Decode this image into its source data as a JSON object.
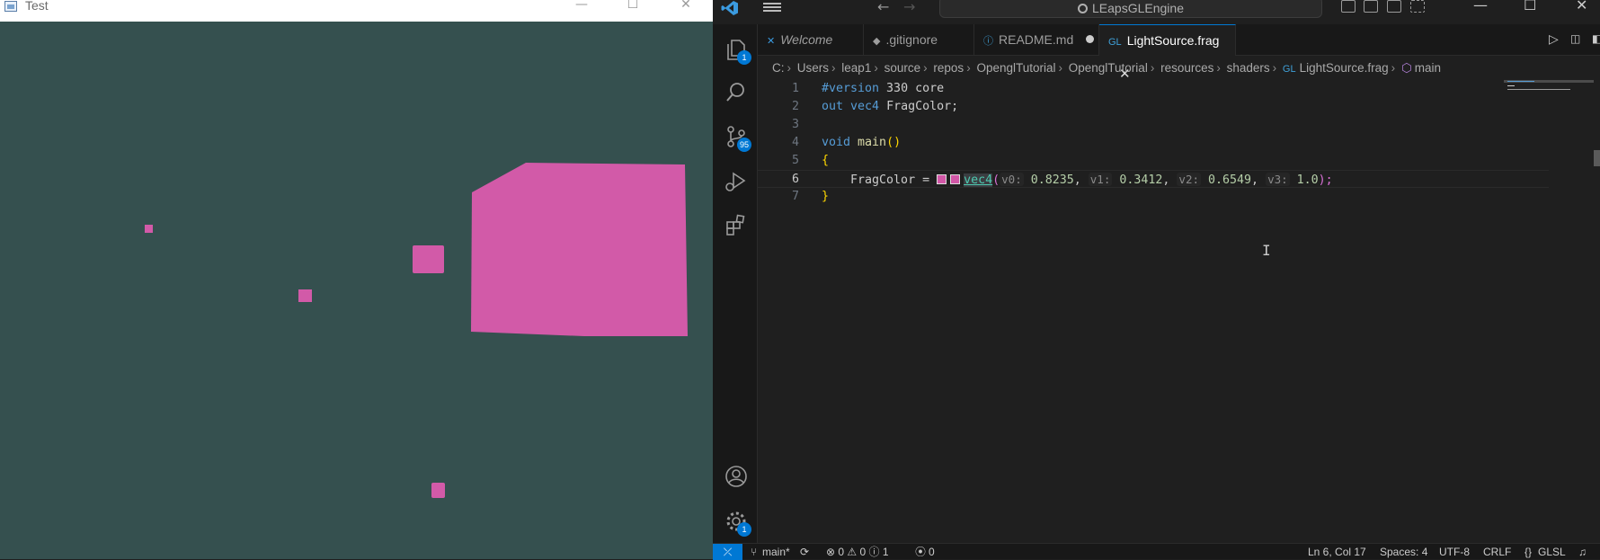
{
  "test_window": {
    "title": "Test",
    "controls": {
      "minimize": "—",
      "maximize": "☐",
      "close": "✕"
    },
    "clear_color": "#35504f",
    "object_color": "#d25aa8"
  },
  "vscode": {
    "title_bar": {
      "search_text": "LEapsGLEngine",
      "back": "←",
      "forward": "→",
      "minimize": "—",
      "maximize": "☐",
      "close": "✕"
    },
    "activity_bar": {
      "explorer_badge": "1",
      "source_control_badge": "95",
      "manage_badge": "1"
    },
    "tabs": [
      {
        "label": "Welcome",
        "icon": "vscode-icon"
      },
      {
        "label": ".gitignore",
        "icon": "diamond-icon",
        "prefix": "◆"
      },
      {
        "label": "README.md",
        "icon": "info-icon",
        "prefix": "ⓘ"
      },
      {
        "label": "LightSource.frag",
        "icon": "glsl-icon",
        "prefix": "GL"
      }
    ],
    "breadcrumb": [
      "C:",
      "Users",
      "leap1",
      "source",
      "repos",
      "OpenglTutorial",
      "OpenglTutorial",
      "resources",
      "shaders",
      "LightSource.frag",
      "main"
    ],
    "code": {
      "line_numbers": [
        "1",
        "2",
        "3",
        "4",
        "5",
        "6",
        "7"
      ],
      "l1_directive": "#version",
      "l1_rest": " 330 core",
      "l2_kw": "out",
      "l2_type": " vec4",
      "l2_rest": " FragColor;",
      "l4_kw": "void",
      "l4_fn": " main",
      "l4_parens": "()",
      "l5_brace": "{",
      "l6_lhs": "    FragColor = ",
      "l6_func": "vec4",
      "l6_open": "(",
      "l6_hint0": "v0:",
      "l6_val0": " 0.8235",
      "l6_comma0": ", ",
      "l6_hint1": "v1:",
      "l6_val1": " 0.3412",
      "l6_comma1": ", ",
      "l6_hint2": "v2:",
      "l6_val2": " 0.6549",
      "l6_comma2": ", ",
      "l6_hint3": "v3:",
      "l6_val3": " 1.0",
      "l6_close": ");",
      "l7_brace": "}"
    },
    "status_bar": {
      "branch": "main*",
      "problems": "⊗ 0 ⚠ 0 ⓘ 1",
      "ports": "0",
      "position": "Ln 6, Col 17",
      "spaces": "Spaces: 4",
      "encoding": "UTF-8",
      "eol": "CRLF",
      "language": "GLSL"
    }
  }
}
